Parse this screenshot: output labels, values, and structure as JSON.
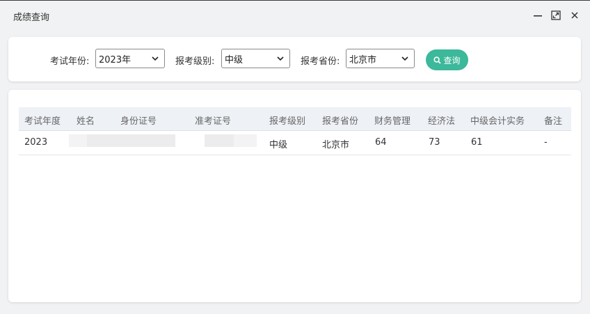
{
  "window": {
    "title": "成绩查询",
    "controls": [
      "minimize-icon",
      "maximize-icon",
      "close-icon"
    ]
  },
  "filters": {
    "year": {
      "label": "考试年份:",
      "value": "2023年"
    },
    "level": {
      "label": "报考级别:",
      "value": "中级"
    },
    "province": {
      "label": "报考省份:",
      "value": "北京市"
    },
    "query_button": {
      "icon": "search-icon",
      "label": "查询"
    }
  },
  "table": {
    "headers": [
      "考试年度",
      "姓名",
      "身份证号",
      "准考证号",
      "报考级别",
      "报考省份",
      "财务管理",
      "经济法",
      "中级会计实务",
      "备注"
    ],
    "rows": [
      {
        "year": "2023",
        "name": "",
        "id_number": "",
        "ticket_number": "",
        "level": "中级",
        "province": "北京市",
        "finance": "64",
        "economic_law": "73",
        "accounting_practice": "61",
        "remark": "-"
      }
    ]
  },
  "colors": {
    "accent": "#3cb89a",
    "header_bg": "#eef1f6",
    "page_bg": "#f1f2f3"
  }
}
